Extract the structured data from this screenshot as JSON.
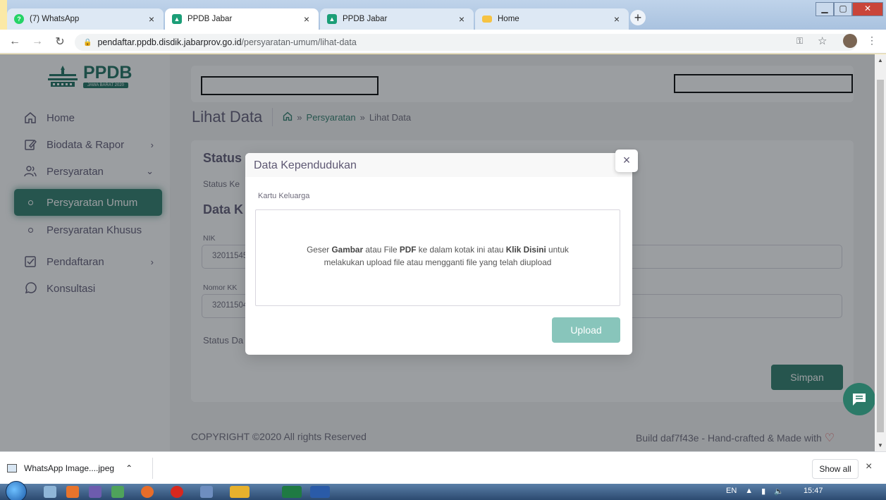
{
  "browser": {
    "tabs": [
      {
        "title": "(7) WhatsApp",
        "active": false,
        "favicon": "whatsapp-icon",
        "color": "#25d366"
      },
      {
        "title": "PPDB Jabar",
        "active": true,
        "favicon": "ppdb-icon",
        "color": "#1b9e77"
      },
      {
        "title": "PPDB Jabar",
        "active": false,
        "favicon": "ppdb-icon",
        "color": "#1b9e77"
      },
      {
        "title": "Home",
        "active": false,
        "favicon": "folder-icon",
        "color": "#f6c343"
      }
    ],
    "url_host": "pendaftar.ppdb.disdik.jabarprov.go.id",
    "url_path": "/persyaratan-umum/lihat-data"
  },
  "sidebar": {
    "logo_text": "PPDB",
    "logo_sub": "JAWA BARAT 2020",
    "items": [
      {
        "label": "Home",
        "icon": "home-icon"
      },
      {
        "label": "Biodata & Rapor",
        "icon": "edit-icon",
        "chevron": "›"
      },
      {
        "label": "Persyaratan",
        "icon": "users-icon",
        "chevron": "⌄"
      },
      {
        "label": "Persyaratan Umum",
        "icon": "circle-icon"
      },
      {
        "label": "Persyaratan Khusus",
        "icon": "circle-icon"
      },
      {
        "label": "Pendaftaran",
        "icon": "check-square-icon",
        "chevron": "›"
      },
      {
        "label": "Konsultasi",
        "icon": "message-circle-icon"
      }
    ]
  },
  "header": {
    "title": "Lihat Data",
    "breadcrumb": {
      "sep": "»",
      "parent": "Persyaratan",
      "current": "Lihat Data"
    }
  },
  "card": {
    "status_heading": "Status",
    "status_text": "Status Ke",
    "data_heading": "Data K",
    "nik_label": "NIK",
    "nik_value": "32011545",
    "kk_label": "Nomor KK",
    "kk_value": "32011504",
    "status_data": "Status Da",
    "save_label": "Simpan"
  },
  "modal": {
    "title": "Data Kependudukan",
    "close": "×",
    "field_label": "Kartu Keluarga",
    "dz_1": "Geser ",
    "dz_b1": "Gambar",
    "dz_2": " atau File ",
    "dz_b2": "PDF",
    "dz_3": " ke dalam kotak ini atau ",
    "dz_b3": "Klik Disini",
    "dz_4": " untuk",
    "dz_line2": "melakukan upload file atau mengganti file yang telah diupload",
    "upload_label": "Upload"
  },
  "footer": {
    "copyright": "COPYRIGHT ©2020 All rights Reserved",
    "build": "Build daf7f43e - Hand-crafted & Made with"
  },
  "downloads": {
    "file": "WhatsApp Image....jpeg",
    "show_all": "Show all",
    "close": "×"
  },
  "taskbar": {
    "lang": "EN",
    "time": "15:47"
  },
  "colors": {
    "brand": "#2b7a68",
    "upload_disabled": "#88c5bb"
  }
}
